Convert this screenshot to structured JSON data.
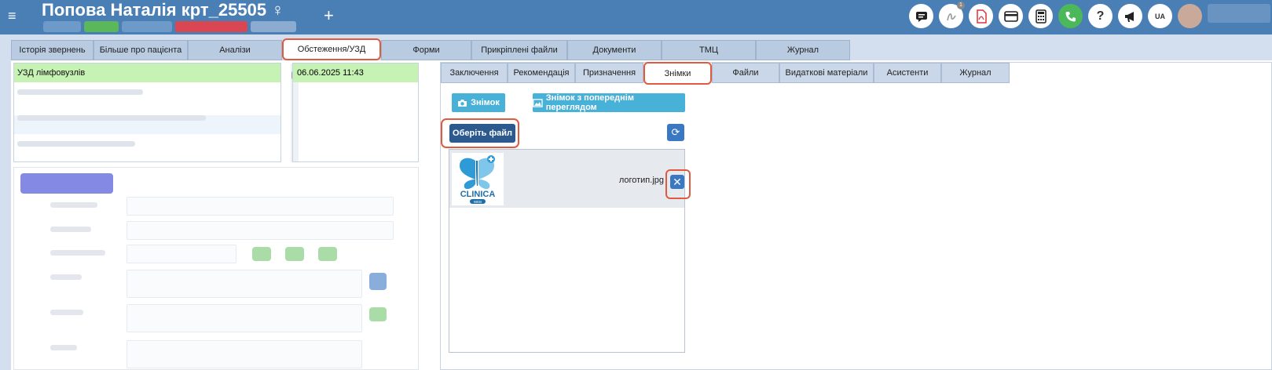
{
  "header": {
    "menu_icon": "≡",
    "title": "Попова Наталія крт_25505 ♀",
    "add_icon": "+",
    "lang": "UA",
    "notif_count": "1"
  },
  "main_tabs": [
    {
      "label": "Історія звернень",
      "active": false
    },
    {
      "label": "Більше про пацієнта",
      "active": false
    },
    {
      "label": "Аналізи",
      "active": false
    },
    {
      "label": "Обстеження/УЗД",
      "active": true
    },
    {
      "label": "Форми",
      "active": false
    },
    {
      "label": "Прикріплені файли",
      "active": false
    },
    {
      "label": "Документи",
      "active": false
    },
    {
      "label": "ТМЦ",
      "active": false
    },
    {
      "label": "Журнал",
      "active": false
    }
  ],
  "exam_list": {
    "selected": "УЗД лімфовузлів",
    "date": "06.06.2025 11:43"
  },
  "sub_tabs": [
    {
      "label": "Заключення",
      "active": false
    },
    {
      "label": "Рекомендація",
      "active": false
    },
    {
      "label": "Призначення",
      "active": false
    },
    {
      "label": "Знімки",
      "active": true
    },
    {
      "label": "Файли",
      "active": false
    },
    {
      "label": "Видаткові матеріали",
      "active": false
    },
    {
      "label": "Асистенти",
      "active": false
    },
    {
      "label": "Журнал",
      "active": false
    }
  ],
  "images": {
    "snapshot_label": "Знімок",
    "snapshot_preview_label": "Знімок з попереднім переглядом",
    "choose_file_label": "Оберіть файл",
    "refresh_icon": "⟳",
    "file_name": "логотип.jpg",
    "delete_icon": "✕",
    "logo_text": "CLINICA",
    "logo_sub": "WEB"
  },
  "colors": {
    "header_bg": "#4a7fb6",
    "selected_row": "#c6f2b4",
    "highlight": "#e05a3f",
    "btn_cyan": "#48b1d7",
    "btn_dark": "#2d5a8e"
  }
}
